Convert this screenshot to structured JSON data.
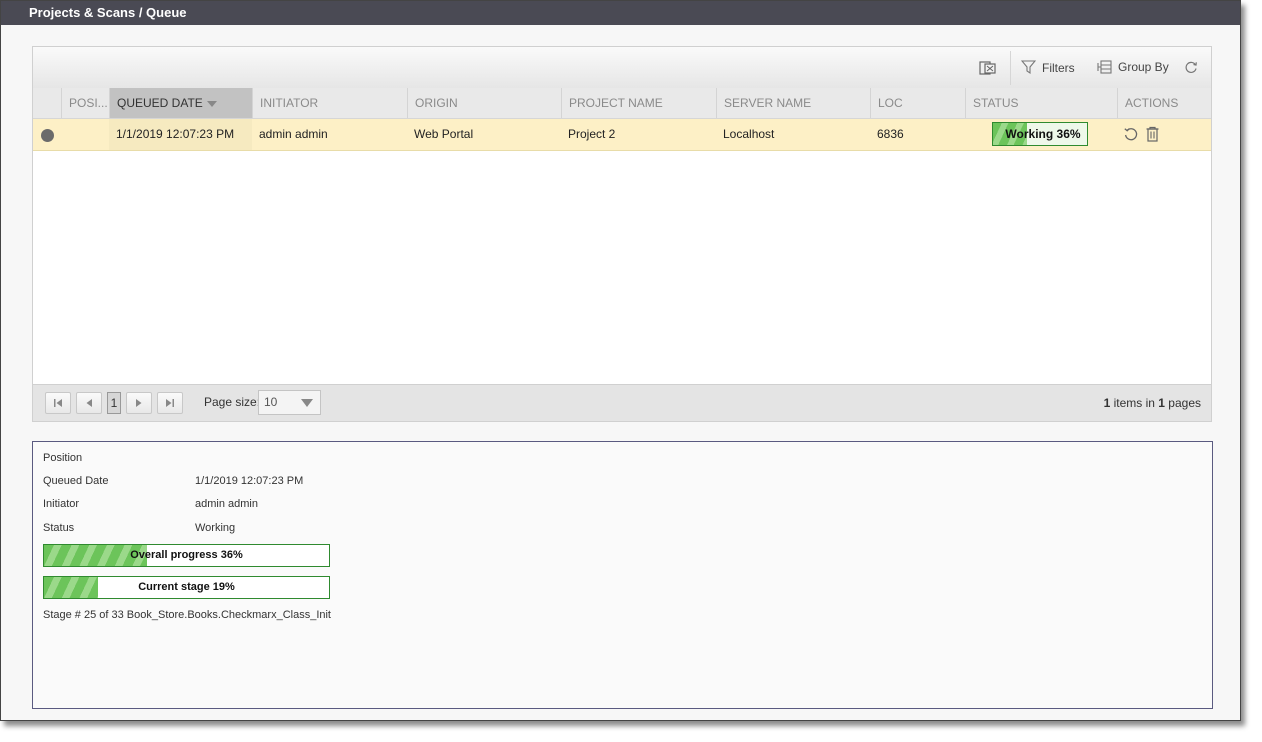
{
  "breadcrumb": "Projects & Scans / Queue",
  "toolbar": {
    "export_icon": "export-excel-icon",
    "filters_label": "Filters",
    "group_by_label": "Group By",
    "refresh_icon": "refresh-icon"
  },
  "columns": {
    "position": "POSI...",
    "queued_date": "QUEUED DATE",
    "initiator": "INITIATOR",
    "origin": "ORIGIN",
    "project_name": "PROJECT NAME",
    "server_name": "SERVER NAME",
    "loc": "LOC",
    "status": "STATUS",
    "actions": "ACTIONS"
  },
  "rows": [
    {
      "position": "",
      "queued_date": "1/1/2019 12:07:23 PM",
      "initiator": "admin admin",
      "origin": "Web Portal",
      "project_name": "Project 2",
      "server_name": "Localhost",
      "loc": "6836",
      "status_text": "Working 36%",
      "status_progress": 0.36
    }
  ],
  "pager": {
    "current_page": "1",
    "page_size_label": "Page size:",
    "page_size_value": "10",
    "items_count": "1",
    "items_in_label": " items in ",
    "pages_count": "1",
    "pages_label": " pages"
  },
  "details": {
    "position_label": "Position",
    "position_value": "",
    "queued_date_label": "Queued Date",
    "queued_date_value": "1/1/2019 12:07:23 PM",
    "initiator_label": "Initiator",
    "initiator_value": "admin admin",
    "status_label": "Status",
    "status_value": "Working",
    "overall_progress_text": "Overall progress 36%",
    "overall_progress": 0.36,
    "current_stage_text": "Current stage 19%",
    "current_stage": 0.19,
    "stage_info": "Stage # 25 of 33 Book_Store.Books.Checkmarx_Class_Init"
  },
  "colors": {
    "titlebar": "#4a4a54",
    "row_highlight": "#fdf0c6",
    "progress_border": "#2f8a2f",
    "progress_fill": "#6cc45a"
  }
}
